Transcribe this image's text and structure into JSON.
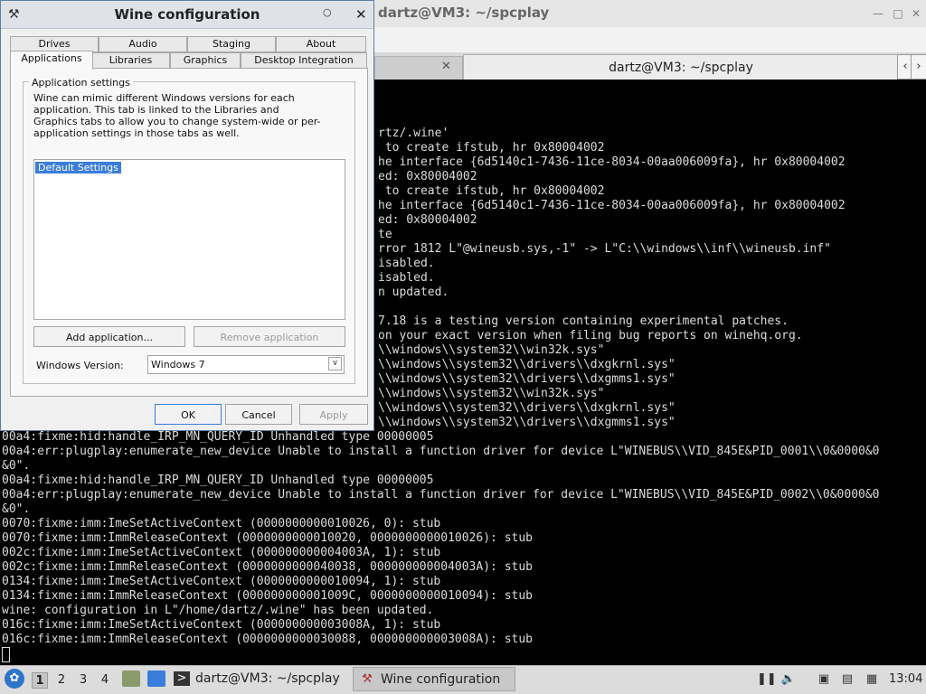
{
  "terminal": {
    "title": "dartz@VM3: ~/spcplay",
    "tab_title": "dartz@VM3: ~/spcplay",
    "lines": [
      "rtz/.wine'",
      " to create ifstub, hr 0x80004002",
      "he interface {6d5140c1-7436-11ce-8034-00aa006009fa}, hr 0x80004002",
      "ed: 0x80004002",
      " to create ifstub, hr 0x80004002",
      "he interface {6d5140c1-7436-11ce-8034-00aa006009fa}, hr 0x80004002",
      "ed: 0x80004002",
      "te",
      "rror 1812 L\"@wineusb.sys,-1\" -> L\"C:\\\\windows\\\\inf\\\\wineusb.inf\"",
      "isabled.",
      "isabled.",
      "n updated.",
      "",
      "7.18 is a testing version containing experimental patches.",
      "on your exact version when filing bug reports on winehq.org.",
      "\\\\windows\\\\system32\\\\win32k.sys\"",
      "\\\\windows\\\\system32\\\\drivers\\\\dxgkrnl.sys\"",
      "\\\\windows\\\\system32\\\\drivers\\\\dxgmms1.sys\"",
      "\\\\windows\\\\system32\\\\win32k.sys\"",
      "\\\\windows\\\\system32\\\\drivers\\\\dxgkrnl.sys\"",
      "\\\\windows\\\\system32\\\\drivers\\\\dxgmms1.sys\"",
      "00a4:fixme:hid:handle_IRP_MN_QUERY_ID Unhandled type 00000005",
      "00a4:err:plugplay:enumerate_new_device Unable to install a function driver for device L\"WINEBUS\\\\VID_845E&PID_0001\\\\0&0000&0",
      "&0\".",
      "00a4:fixme:hid:handle_IRP_MN_QUERY_ID Unhandled type 00000005",
      "00a4:err:plugplay:enumerate_new_device Unable to install a function driver for device L\"WINEBUS\\\\VID_845E&PID_0002\\\\0&0000&0",
      "&0\".",
      "0070:fixme:imm:ImeSetActiveContext (0000000000010026, 0): stub",
      "0070:fixme:imm:ImmReleaseContext (0000000000010020, 0000000000010026): stub",
      "002c:fixme:imm:ImeSetActiveContext (000000000004003A, 1): stub",
      "002c:fixme:imm:ImmReleaseContext (0000000000040038, 000000000004003A): stub",
      "0134:fixme:imm:ImeSetActiveContext (0000000000010094, 1): stub",
      "0134:fixme:imm:ImmReleaseContext (000000000001009C, 0000000000010094): stub",
      "wine: configuration in L\"/home/dartz/.wine\" has been updated.",
      "016c:fixme:imm:ImeSetActiveContext (000000000003008A, 1): stub",
      "016c:fixme:imm:ImmReleaseContext (0000000000030088, 000000000003008A): stub"
    ]
  },
  "dialog": {
    "title": "Wine configuration",
    "tabs_row1": [
      "Drives",
      "Audio",
      "Staging",
      "About"
    ],
    "tabs_row2": [
      "Applications",
      "Libraries",
      "Graphics",
      "Desktop Integration"
    ],
    "group_title": "Application settings",
    "description": "Wine can mimic different Windows versions for each application. This tab is linked to the Libraries and Graphics tabs to allow you to change system-wide or per-application settings in those tabs as well.",
    "list_items": [
      "Default Settings"
    ],
    "add_button": "Add application...",
    "remove_button": "Remove application",
    "windows_version_label": "Windows Version:",
    "windows_version_value": "Windows 7",
    "ok": "OK",
    "cancel": "Cancel",
    "apply": "Apply"
  },
  "taskbar": {
    "workspaces": [
      "1",
      "2",
      "3",
      "4"
    ],
    "tasks": [
      "dartz@VM3: ~/spcplay",
      "Wine configuration"
    ],
    "clock": "13:04"
  }
}
